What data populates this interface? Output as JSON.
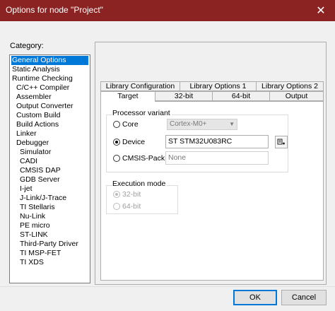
{
  "window": {
    "title": "Options for node \"Project\"",
    "close_glyph": "✕"
  },
  "category": {
    "label": "Category:",
    "items": [
      {
        "label": "General Options",
        "level": 0,
        "selected": true
      },
      {
        "label": "Static Analysis",
        "level": 0
      },
      {
        "label": "Runtime Checking",
        "level": 0
      },
      {
        "label": "C/C++ Compiler",
        "level": 1
      },
      {
        "label": "Assembler",
        "level": 1
      },
      {
        "label": "Output Converter",
        "level": 1
      },
      {
        "label": "Custom Build",
        "level": 1
      },
      {
        "label": "Build Actions",
        "level": 1
      },
      {
        "label": "Linker",
        "level": 1
      },
      {
        "label": "Debugger",
        "level": 1
      },
      {
        "label": "Simulator",
        "level": 2
      },
      {
        "label": "CADI",
        "level": 2
      },
      {
        "label": "CMSIS DAP",
        "level": 2
      },
      {
        "label": "GDB Server",
        "level": 2
      },
      {
        "label": "I-jet",
        "level": 2
      },
      {
        "label": "J-Link/J-Trace",
        "level": 2
      },
      {
        "label": "TI Stellaris",
        "level": 2
      },
      {
        "label": "Nu-Link",
        "level": 2
      },
      {
        "label": "PE micro",
        "level": 2
      },
      {
        "label": "ST-LINK",
        "level": 2
      },
      {
        "label": "Third-Party Driver",
        "level": 2
      },
      {
        "label": "TI MSP-FET",
        "level": 2
      },
      {
        "label": "TI XDS",
        "level": 2
      }
    ]
  },
  "tabs": {
    "row_back": [
      "Library Configuration",
      "Library Options 1",
      "Library Options 2"
    ],
    "row_front": [
      "Target",
      "32-bit",
      "64-bit",
      "Output"
    ],
    "active": "Target"
  },
  "processor_variant": {
    "label": "Processor variant",
    "core_label": "Core",
    "core_value": "Cortex-M0+",
    "device_label": "Device",
    "device_value": "ST STM32U083RC",
    "cmsis_label": "CMSIS-Pack",
    "cmsis_value": "None",
    "selected": "Device"
  },
  "execution_mode": {
    "label": "Execution mode",
    "options": [
      "32-bit",
      "64-bit"
    ],
    "selected": "32-bit"
  },
  "buttons": {
    "ok": "OK",
    "cancel": "Cancel"
  }
}
